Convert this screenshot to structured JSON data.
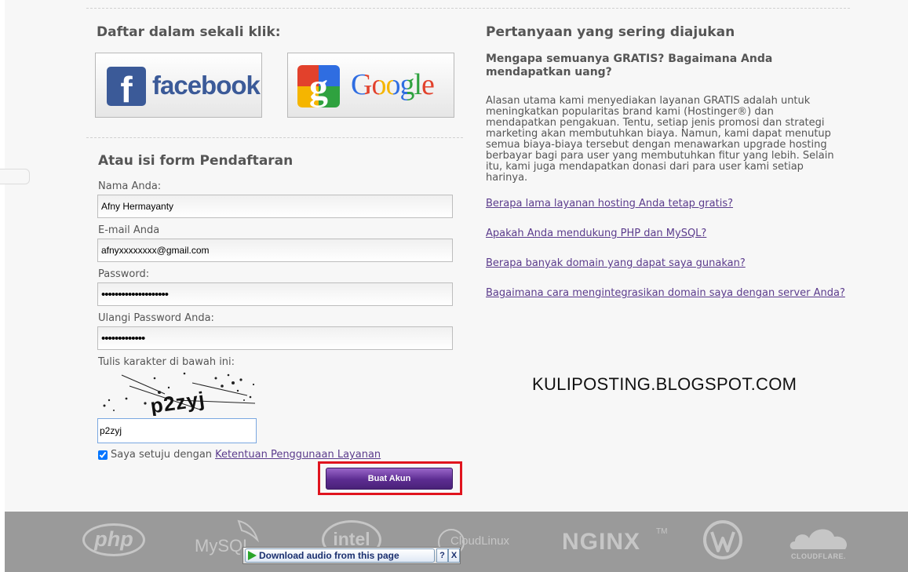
{
  "signup": {
    "quick_title": "Daftar dalam sekali klik:",
    "facebook_label": "facebook",
    "facebook_glyph": "f",
    "google_label": "Google",
    "google_glyph": "g",
    "form_title": "Atau isi form Pendaftaran",
    "name_label": "Nama Anda:",
    "name_value": "Afny Hermayanty",
    "email_label": "E-mail Anda",
    "email_value": "afnyxxxxxxxx@gmail.com",
    "password_label": "Password:",
    "password_value": "••••••••••••••••••••",
    "password_repeat_label": "Ulangi Password Anda:",
    "password_repeat_value": "•••••••••••••",
    "captcha_label": "Tulis karakter di bawah ini:",
    "captcha_text": "p2zyj",
    "captcha_value": "p2zyj",
    "agree_text": "Saya setuju dengan",
    "terms_link": "Ketentuan Penggunaan Layanan",
    "submit_label": "Buat Akun"
  },
  "faq": {
    "title": "Pertanyaan yang sering diajukan",
    "question": "Mengapa semuanya GRATIS? Bagaimana Anda mendapatkan uang?",
    "answer": "Alasan utama kami menyediakan layanan GRATIS adalah untuk meningkatkan popularitas brand kami (Hostinger®) dan mendapatkan pengakuan. Tentu, setiap jenis promosi dan strategi marketing akan membutuhkan biaya. Namun, kami dapat menutup semua biaya-biaya tersebut dengan menawarkan upgrade hosting berbayar bagi para user yang membutuhkan fitur yang lebih. Selain itu, kami juga mendapatkan donasi dari para user kami setiap harinya.",
    "links": [
      "Berapa lama layanan hosting Anda tetap gratis?",
      "Apakah Anda mendukung PHP dan MySQL?",
      "Berapa banyak domain yang dapat saya gunakan?",
      "Bagaimana cara mengintegrasikan domain saya dengan server Anda?"
    ]
  },
  "watermark": "KULIPOSTING.BLOGSPOT.COM",
  "footer": {
    "logos": [
      "php",
      "MySQL",
      "intel",
      "CloudLinux",
      "NGINX",
      "CLOUDFLARE."
    ],
    "tm": "TM"
  },
  "download_bar": {
    "label": "Download audio from this page",
    "help": "?",
    "close": "X"
  },
  "colors": {
    "facebook": "#3b5a98",
    "button": "#5c2c91",
    "highlight": "#e0141e",
    "link": "#5b3b8c",
    "footer": "#9a9a9a"
  }
}
